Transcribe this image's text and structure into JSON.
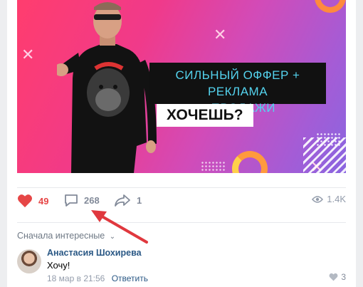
{
  "post": {
    "banner": {
      "offer_line1": "СИЛЬНЫЙ ОФФЕР + РЕКЛАМА",
      "offer_line2": "+ ПРОДАЖИ",
      "offer_cta": "ХОЧЕШЬ?"
    },
    "stats": {
      "likes": "49",
      "comments": "268",
      "shares": "1",
      "views": "1.4K"
    },
    "colors": {
      "accent_like": "#e64646",
      "link": "#2a5885",
      "annotation_arrow": "#e0383e"
    }
  },
  "comments": {
    "sort_label": "Сначала интересные",
    "items": [
      {
        "author": "Анастасия Шохирева",
        "text": "Хочу!",
        "date": "18 мар в 21:56",
        "reply_label": "Ответить",
        "likes": "3"
      }
    ]
  }
}
